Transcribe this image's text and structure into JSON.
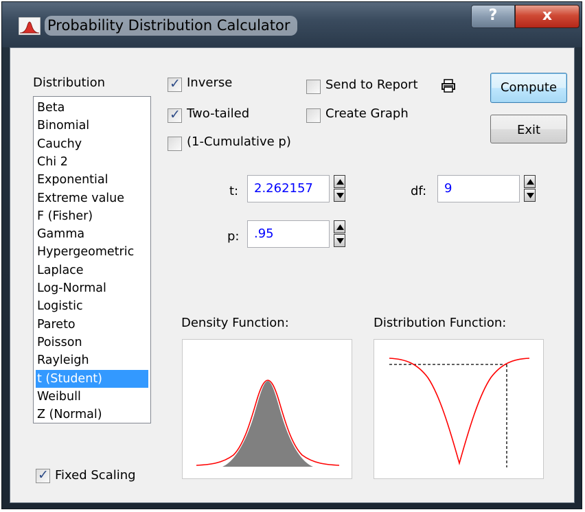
{
  "window": {
    "title": "Probability Distribution Calculator",
    "help_label": "?",
    "close_label": "x"
  },
  "distribution": {
    "label": "Distribution",
    "items": [
      "Beta",
      "Binomial",
      "Cauchy",
      "Chi 2",
      "Exponential",
      "Extreme value",
      "F (Fisher)",
      "Gamma",
      "Hypergeometric",
      "Laplace",
      "Log-Normal",
      "Logistic",
      "Pareto",
      "Poisson",
      "Rayleigh",
      "t (Student)",
      "Weibull",
      "Z (Normal)"
    ],
    "selected": "t (Student)"
  },
  "options": {
    "inverse": {
      "label": "Inverse",
      "checked": true
    },
    "two_tailed": {
      "label": "Two-tailed",
      "checked": true
    },
    "one_minus_cumulative": {
      "label": "(1-Cumulative p)",
      "checked": false
    },
    "send_to_report": {
      "label": "Send to Report",
      "checked": false
    },
    "create_graph": {
      "label": "Create Graph",
      "checked": false
    },
    "fixed_scaling": {
      "label": "Fixed Scaling",
      "checked": true
    }
  },
  "buttons": {
    "compute": "Compute",
    "exit": "Exit"
  },
  "params": {
    "t": {
      "label": "t:",
      "value": "2.262157"
    },
    "df": {
      "label": "df:",
      "value": "9"
    },
    "p": {
      "label": "p:",
      "value": ".95"
    }
  },
  "graphs": {
    "density_title": "Density Function:",
    "distribution_title": "Distribution Function:"
  },
  "colors": {
    "curve": "#ff0000",
    "fill": "#808080",
    "selection": "#3399ff",
    "value_text": "#0000ff"
  },
  "icons": {
    "printer": "printer-icon",
    "app": "distribution-curve-icon"
  }
}
